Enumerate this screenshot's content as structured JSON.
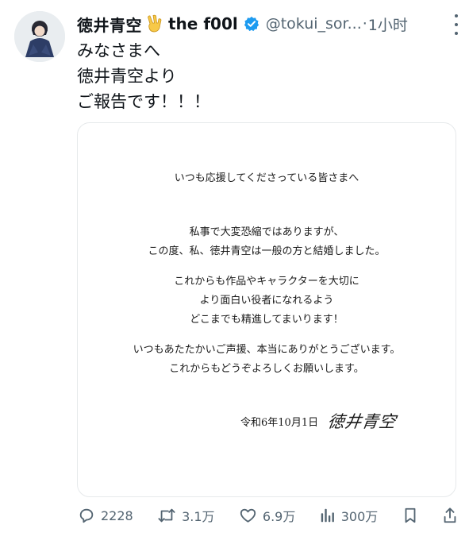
{
  "post": {
    "display_name": "徳井青空",
    "name_suffix": "the f00l",
    "handle": "@tokui_sor...",
    "separator": "·",
    "time": "1小时",
    "text_lines": [
      "みなさまへ",
      "徳井青空より",
      "ご報告です！！！"
    ]
  },
  "image_letter": {
    "greeting": "いつも応援してくださっている皆さまへ",
    "para1": [
      "私事で大変恐縮ではありますが、",
      "この度、私、徳井青空は一般の方と結婚しました。"
    ],
    "para2": [
      "これからも作品やキャラクターを大切に",
      "より面白い役者になれるよう",
      "どこまでも精進してまいります！"
    ],
    "para3": [
      "いつもあたたかいご声援、本当にありがとうございます。",
      "これからもどうぞよろしくお願いします。"
    ],
    "date": "令和6年10月1日",
    "signature": "徳井青空"
  },
  "actions": {
    "replies": "2228",
    "reposts": "3.1万",
    "likes": "6.9万",
    "views": "300万"
  },
  "colors": {
    "text": "#0f1419",
    "secondary": "#536471",
    "verified": "#1d9bf0",
    "border": "#e6e9eb"
  },
  "icons": [
    "victory-hand-icon",
    "verified-badge-icon",
    "more-icon",
    "reply-icon",
    "repost-icon",
    "like-icon",
    "views-icon",
    "bookmark-icon",
    "share-icon"
  ]
}
